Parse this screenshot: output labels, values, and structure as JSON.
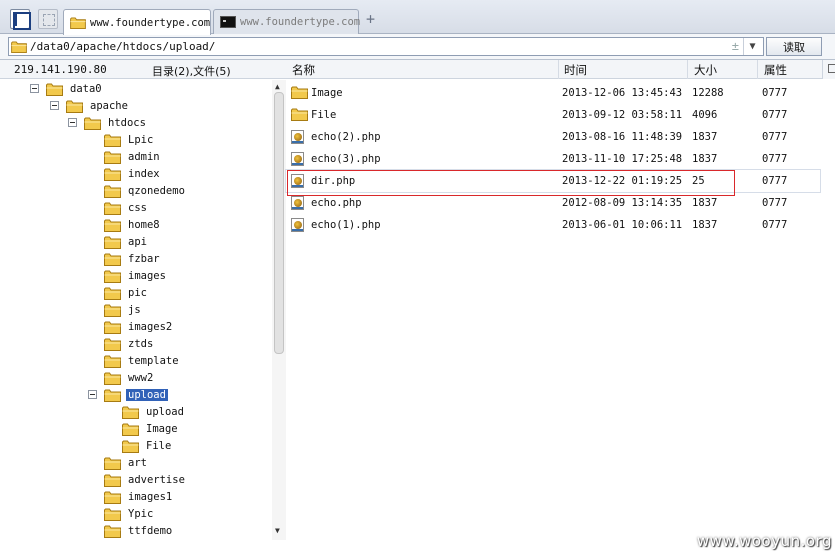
{
  "tabs": [
    {
      "label": "www.foundertype.com",
      "icon": "folder-icon",
      "active": true
    },
    {
      "label": "www.foundertype.com",
      "icon": "terminal-icon",
      "active": false
    }
  ],
  "address": {
    "path": "/data0/apache/htdocs/upload/",
    "plus": "±",
    "read_label": "读取"
  },
  "left_header": {
    "ip": "219.141.190.80",
    "summary": "目录(2),文件(5)"
  },
  "tree": [
    {
      "label": "data0",
      "indent": 0,
      "expanded": true
    },
    {
      "label": "apache",
      "indent": 1,
      "expanded": true
    },
    {
      "label": "htdocs",
      "indent": 2,
      "expanded": true
    },
    {
      "label": "Lpic",
      "indent": 3
    },
    {
      "label": "admin",
      "indent": 3
    },
    {
      "label": "index",
      "indent": 3
    },
    {
      "label": "qzonedemo",
      "indent": 3
    },
    {
      "label": "css",
      "indent": 3
    },
    {
      "label": "home8",
      "indent": 3
    },
    {
      "label": "api",
      "indent": 3
    },
    {
      "label": "fzbar",
      "indent": 3
    },
    {
      "label": "images",
      "indent": 3
    },
    {
      "label": "pic",
      "indent": 3
    },
    {
      "label": "js",
      "indent": 3
    },
    {
      "label": "images2",
      "indent": 3
    },
    {
      "label": "ztds",
      "indent": 3
    },
    {
      "label": "template",
      "indent": 3
    },
    {
      "label": "www2",
      "indent": 3
    },
    {
      "label": "upload",
      "indent": 3,
      "expanded": true,
      "selected": true
    },
    {
      "label": "upload",
      "indent": 4
    },
    {
      "label": "Image",
      "indent": 4
    },
    {
      "label": "File",
      "indent": 4
    },
    {
      "label": "art",
      "indent": 3
    },
    {
      "label": "advertise",
      "indent": 3
    },
    {
      "label": "images1",
      "indent": 3
    },
    {
      "label": "Ypic",
      "indent": 3
    },
    {
      "label": "ttfdemo",
      "indent": 3
    }
  ],
  "list": {
    "columns": {
      "name": "名称",
      "time": "时间",
      "size": "大小",
      "attr": "属性"
    },
    "rows": [
      {
        "name": "Image",
        "type": "folder",
        "time": "2013-12-06 13:45:43",
        "size": "12288",
        "attr": "0777"
      },
      {
        "name": "File",
        "type": "folder",
        "time": "2013-09-12 03:58:11",
        "size": "4096",
        "attr": "0777"
      },
      {
        "name": "echo(2).php",
        "type": "php",
        "time": "2013-08-16 11:48:39",
        "size": "1837",
        "attr": "0777"
      },
      {
        "name": "echo(3).php",
        "type": "php",
        "time": "2013-11-10 17:25:48",
        "size": "1837",
        "attr": "0777"
      },
      {
        "name": "dir.php",
        "type": "php",
        "time": "2013-12-22 01:19:25",
        "size": "25",
        "attr": "0777",
        "highlighted": true
      },
      {
        "name": "echo.php",
        "type": "php",
        "time": "2012-08-09 13:14:35",
        "size": "1837",
        "attr": "0777"
      },
      {
        "name": "echo(1).php",
        "type": "php",
        "time": "2013-06-01 10:06:11",
        "size": "1837",
        "attr": "0777"
      }
    ]
  },
  "watermark": "www.wooyun.org",
  "colors": {
    "selection": "#3162b8",
    "folder": "#f2c94c",
    "highlight_border": "#d9282b"
  }
}
